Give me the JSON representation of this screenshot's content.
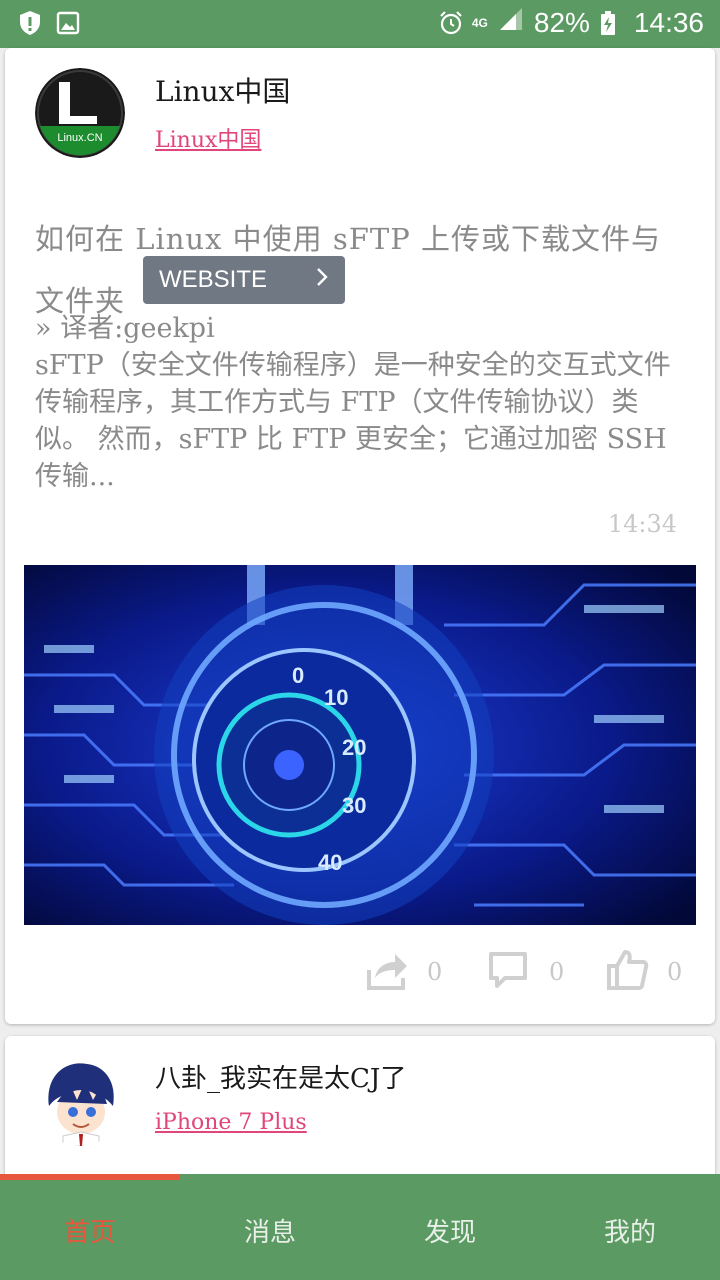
{
  "status_bar": {
    "left_icons": [
      "shield-icon",
      "image-icon"
    ],
    "alarm_icon": "alarm-icon",
    "network": "4G",
    "battery_percent": "82%",
    "charging_icon": "charging-icon",
    "time": "14:36"
  },
  "posts": [
    {
      "author": "Linux中国",
      "source": "Linux中国",
      "avatar_label": "Linux.CN",
      "title": "如何在 Linux 中使用 sFTP 上传或下载文件与文件夹",
      "website_button": "WEBSITE",
      "body": "» 译者:geekpi\nsFTP（安全文件传输程序）是一种安全的交互式文件传输程序，其工作方式与 FTP（文件传输协议）类似。 然而，sFTP 比 FTP 更安全；它通过加密 SSH 传输...",
      "time": "14:34",
      "hero_dial_numbers": [
        "0",
        "10",
        "20",
        "30",
        "40"
      ],
      "actions": {
        "share_count": "0",
        "comment_count": "0",
        "like_count": "0"
      }
    },
    {
      "author": "八卦_我实在是太CJ了",
      "source": "iPhone 7 Plus"
    }
  ],
  "bottom_nav": {
    "items": [
      "首页",
      "消息",
      "发现",
      "我的"
    ],
    "active_index": 0
  },
  "colors": {
    "status_bar": "#5b9a62",
    "bottom_nav": "#5b9a62",
    "accent_active": "#e8563d",
    "link_pink": "#e0457b"
  }
}
